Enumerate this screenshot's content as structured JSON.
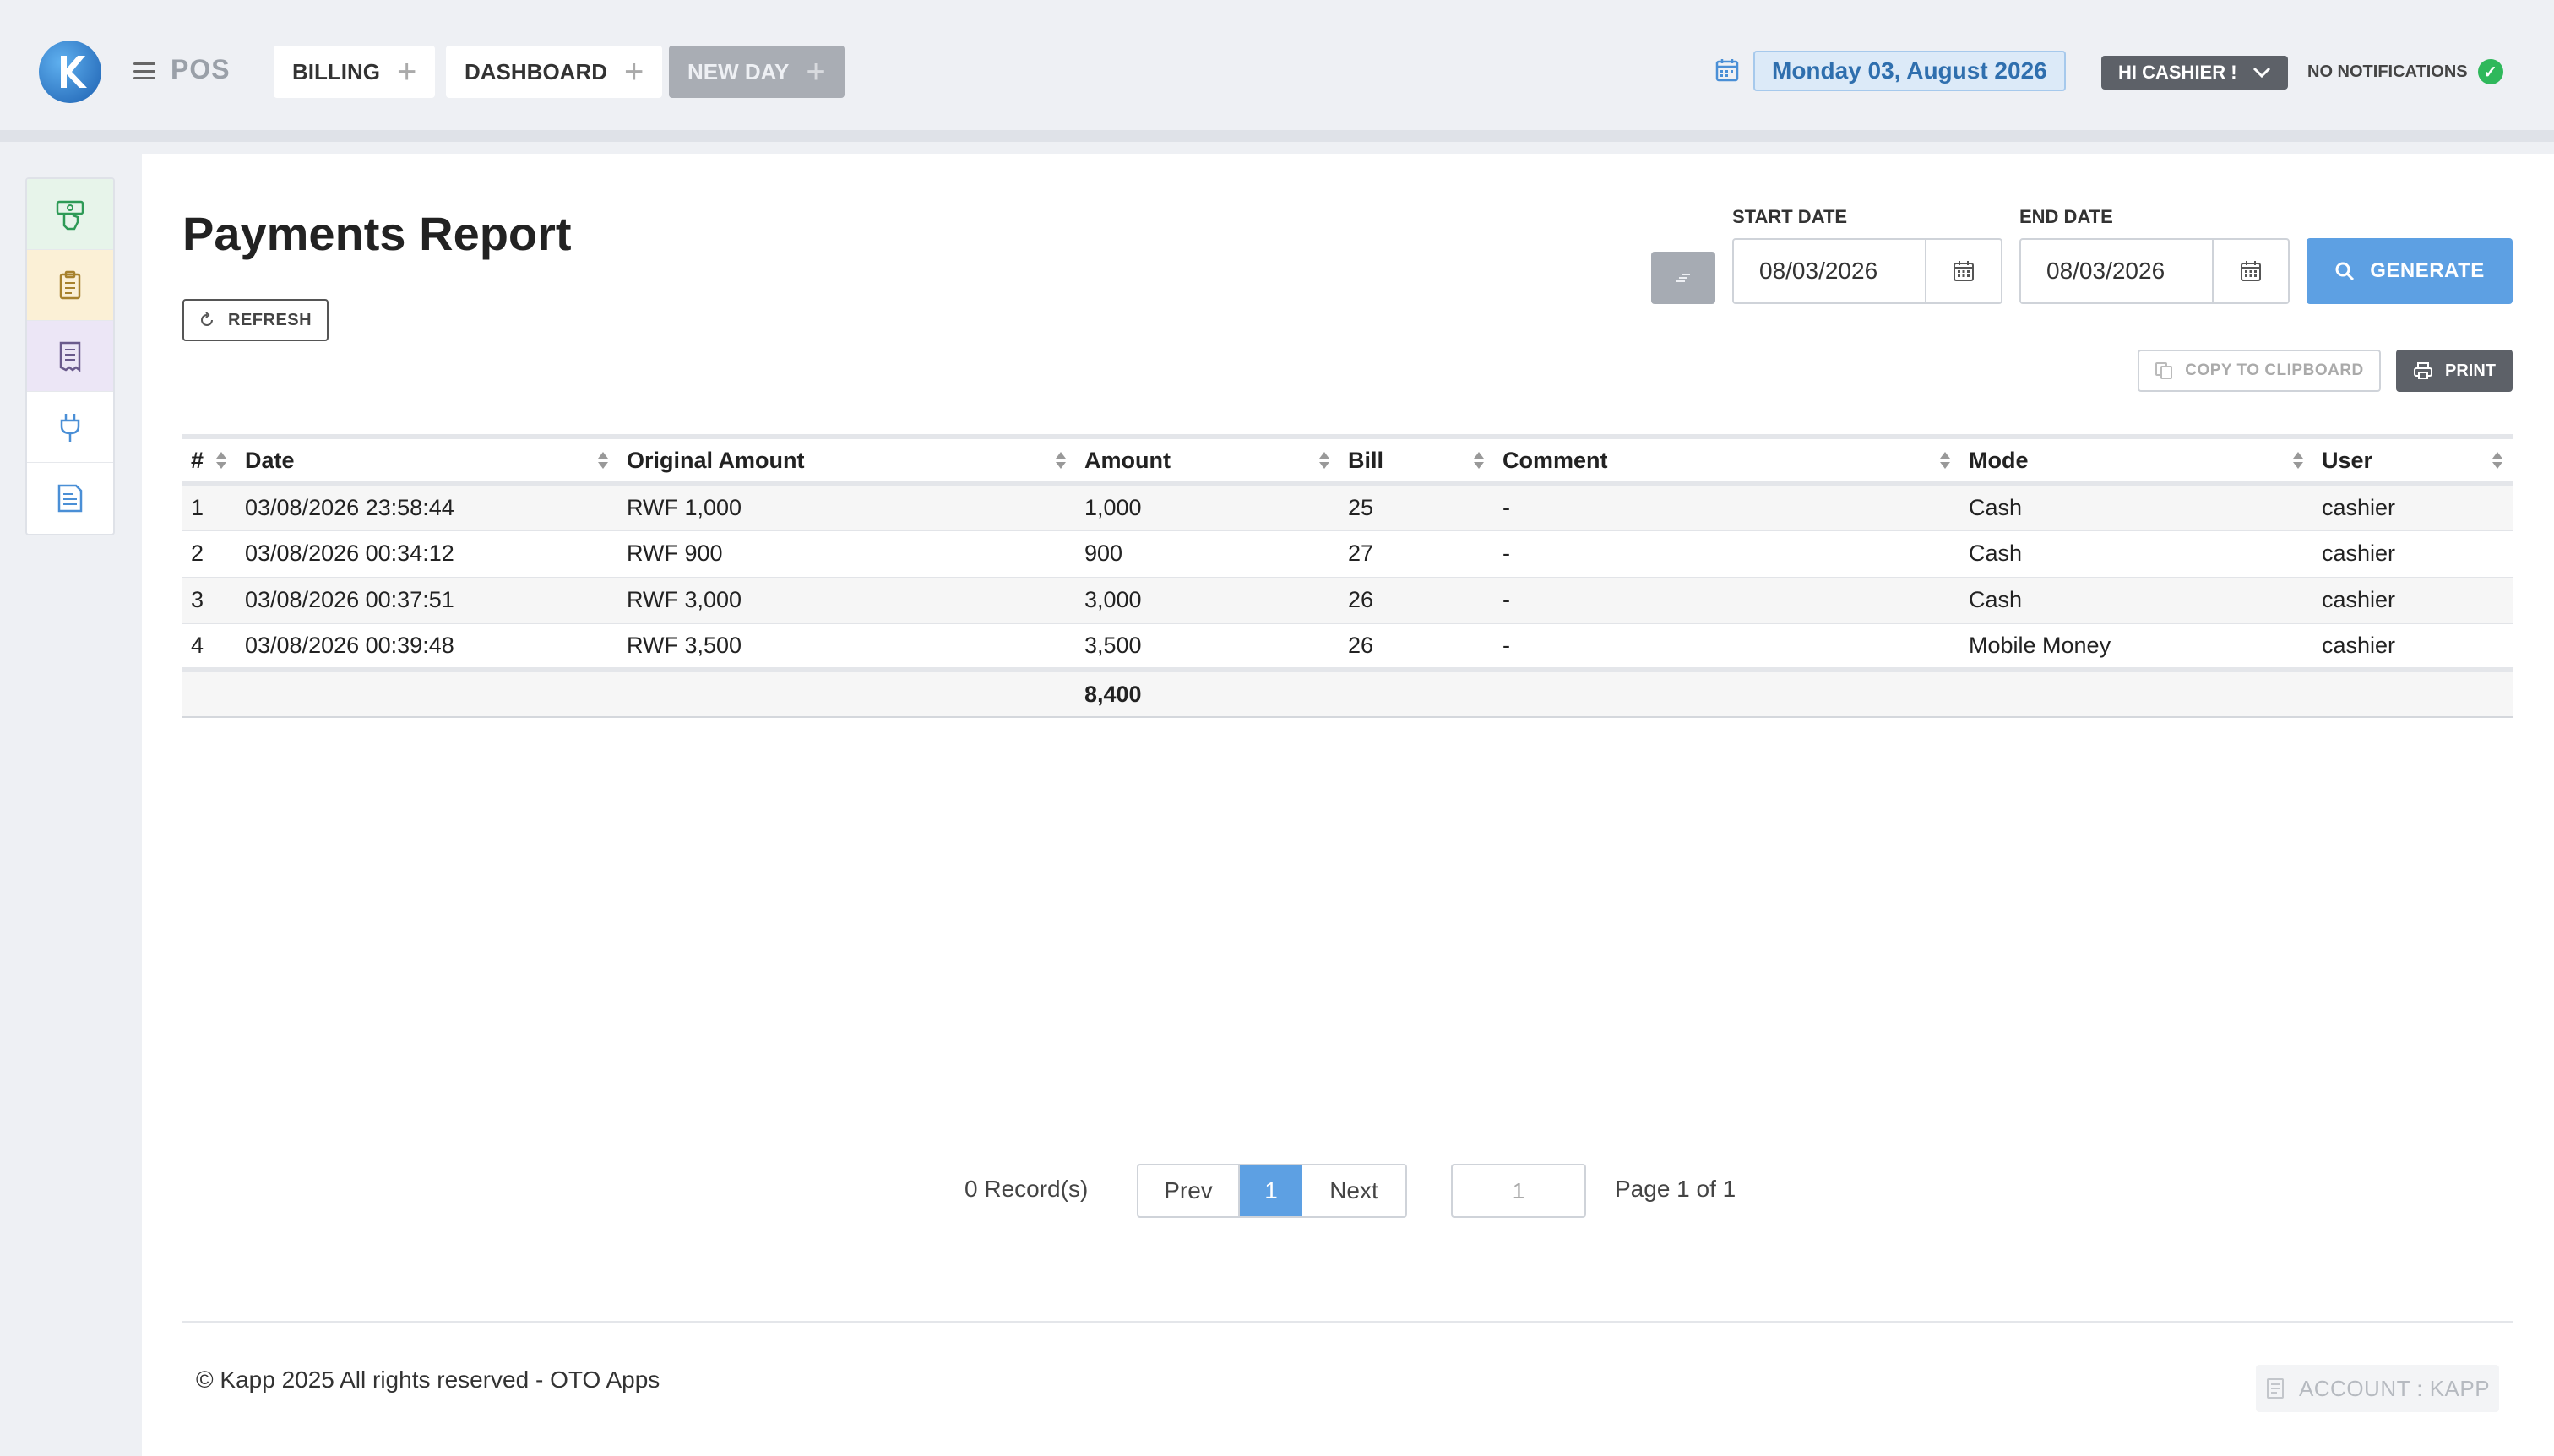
{
  "header": {
    "brand": "POS",
    "tabs": [
      {
        "label": "BILLING",
        "disabled": false
      },
      {
        "label": "DASHBOARD",
        "disabled": false
      },
      {
        "label": "NEW DAY",
        "disabled": true
      }
    ],
    "current_date": "Monday 03, August 2026",
    "user_menu_label": "HI CASHIER !",
    "notifications": "NO NOTIFICATIONS"
  },
  "sidebar": {
    "items": [
      {
        "icon": "money-hand-icon",
        "bg": "#e7f4ea"
      },
      {
        "icon": "clipboard-icon",
        "bg": "#fbf0d6"
      },
      {
        "icon": "receipt-icon",
        "bg": "#ece6f6"
      },
      {
        "icon": "plug-icon",
        "bg": "#ffffff"
      },
      {
        "icon": "document-icon",
        "bg": "#ffffff"
      }
    ]
  },
  "report": {
    "title": "Payments Report",
    "refresh_label": "REFRESH",
    "start_date_label": "START DATE",
    "start_date_value": "08/03/2026",
    "end_date_label": "END DATE",
    "end_date_value": "08/03/2026",
    "generate_label": "GENERATE",
    "copy_label": "COPY TO CLIPBOARD",
    "print_label": "PRINT"
  },
  "table": {
    "columns": [
      "#",
      "Date",
      "Original Amount",
      "Amount",
      "Bill",
      "Comment",
      "Mode",
      "User"
    ],
    "rows": [
      [
        "1",
        "03/08/2026 23:58:44",
        "RWF 1,000",
        "1,000",
        "25",
        "-",
        "Cash",
        "cashier"
      ],
      [
        "2",
        "03/08/2026 00:34:12",
        "RWF 900",
        "900",
        "27",
        "-",
        "Cash",
        "cashier"
      ],
      [
        "3",
        "03/08/2026 00:37:51",
        "RWF 3,000",
        "3,000",
        "26",
        "-",
        "Cash",
        "cashier"
      ],
      [
        "4",
        "03/08/2026 00:39:48",
        "RWF 3,500",
        "3,500",
        "26",
        "-",
        "Mobile Money",
        "cashier"
      ]
    ],
    "total_amount": "8,400"
  },
  "pagination": {
    "records": "0 Record(s)",
    "prev": "Prev",
    "current": "1",
    "next": "Next",
    "page_input": "1",
    "page_of": "Page 1 of 1"
  },
  "footer": {
    "copyright": "© Kapp 2025 All rights reserved - OTO Apps",
    "account": "ACCOUNT : KAPP"
  },
  "colors": {
    "accent": "#5da0e3",
    "dark_button": "#5d6168",
    "success": "#2fb85b",
    "date_text": "#2f6fae"
  }
}
